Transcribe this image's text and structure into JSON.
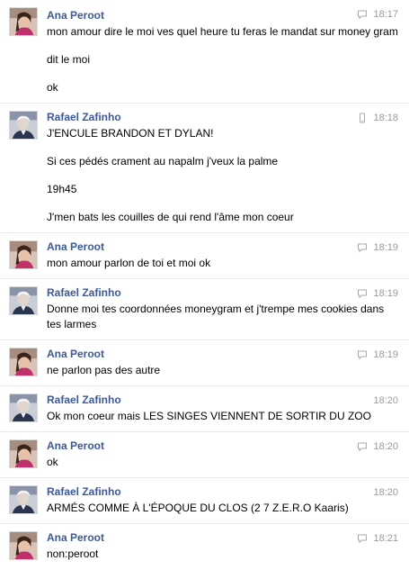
{
  "thread": {
    "groups": [
      {
        "sender": "Ana Peroot",
        "time": "18:17",
        "source_icon": "chat-bubble-icon",
        "messages": [
          "mon amour dire le moi ves quel heure tu feras le mandat sur money gram",
          "dit le moi",
          "ok"
        ]
      },
      {
        "sender": "Rafael Zafinho",
        "time": "18:18",
        "source_icon": "mobile-phone-icon",
        "messages": [
          "J'ENCULE BRANDON ET DYLAN!",
          "Si ces pédés crament au napalm j'veux la palme",
          "19h45",
          "J'men bats les couilles de qui rend l'âme mon coeur"
        ]
      },
      {
        "sender": "Ana Peroot",
        "time": "18:19",
        "source_icon": "chat-bubble-icon",
        "messages": [
          "mon amour parlon de toi et moi ok"
        ]
      },
      {
        "sender": "Rafael Zafinho",
        "time": "18:19",
        "source_icon": "chat-bubble-icon",
        "messages": [
          "Donne moi tes coordonnées moneygram et j'trempe mes cookies dans tes larmes"
        ]
      },
      {
        "sender": "Ana Peroot",
        "time": "18:19",
        "source_icon": "chat-bubble-icon",
        "messages": [
          "ne parlon pas des autre"
        ]
      },
      {
        "sender": "Rafael Zafinho",
        "time": "18:20",
        "source_icon": "",
        "messages": [
          "Ok mon coeur mais LES SINGES VIENNENT DE SORTIR DU ZOO"
        ]
      },
      {
        "sender": "Ana Peroot",
        "time": "18:20",
        "source_icon": "chat-bubble-icon",
        "messages": [
          "ok"
        ]
      },
      {
        "sender": "Rafael Zafinho",
        "time": "18:20",
        "source_icon": "",
        "messages": [
          "ARMÉS COMME À L'ÉPOQUE DU CLOS (2 7 Z.E.R.O Kaaris)"
        ]
      },
      {
        "sender": "Ana Peroot",
        "time": "18:21",
        "source_icon": "chat-bubble-icon",
        "messages": [
          "non:peroot"
        ]
      }
    ]
  },
  "colors": {
    "sender_link": "#3b5998",
    "timestamp": "#999999",
    "divider": "#e9e9e9"
  }
}
